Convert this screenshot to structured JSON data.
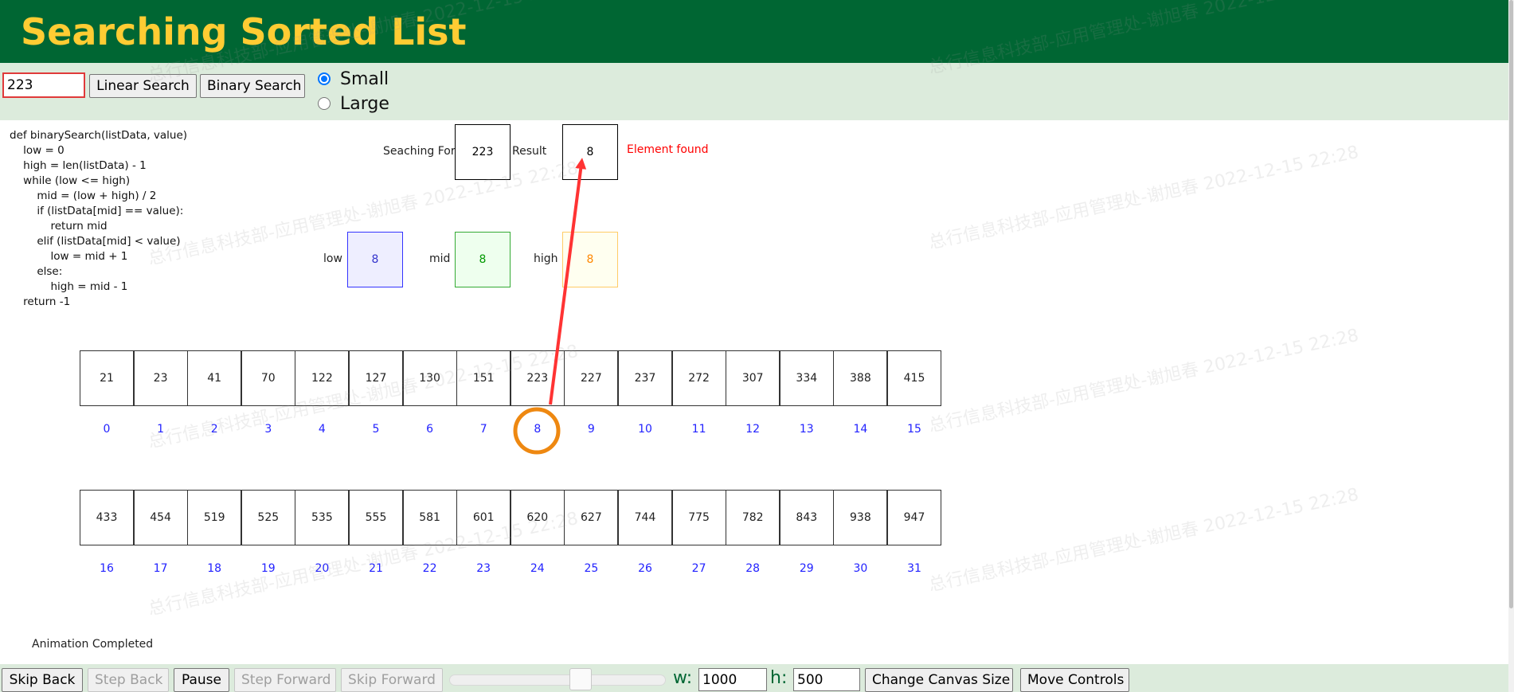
{
  "header": {
    "title": "Searching Sorted List"
  },
  "controls": {
    "search_value": "223",
    "linear_search_label": "Linear Search",
    "binary_search_label": "Binary Search",
    "radio_options": [
      {
        "label": "Small",
        "selected": true
      },
      {
        "label": "Large",
        "selected": false
      }
    ]
  },
  "code": {
    "lines": [
      "def binarySearch(listData, value)",
      "    low = 0",
      "    high = len(listData) - 1",
      "    while (low <= high)",
      "        mid = (low + high) / 2",
      "        if (listData[mid] == value):",
      "            return mid",
      "        elif (listData[mid] < value)",
      "            low = mid + 1",
      "        else:",
      "            high = mid - 1",
      "    return -1"
    ]
  },
  "search": {
    "searching_for_label": "Seaching For",
    "searching_for_value": "223",
    "result_label": "Result",
    "result_value": "8",
    "result_message": "Element found"
  },
  "pointers": {
    "low_label": "low",
    "low_value": "8",
    "mid_label": "mid",
    "mid_value": "8",
    "high_label": "high",
    "high_value": "8"
  },
  "list": {
    "row1_values": [
      "21",
      "23",
      "41",
      "70",
      "122",
      "127",
      "130",
      "151",
      "223",
      "227",
      "237",
      "272",
      "307",
      "334",
      "388",
      "415"
    ],
    "row1_indices": [
      "0",
      "1",
      "2",
      "3",
      "4",
      "5",
      "6",
      "7",
      "8",
      "9",
      "10",
      "11",
      "12",
      "13",
      "14",
      "15"
    ],
    "row2_values": [
      "433",
      "454",
      "519",
      "525",
      "535",
      "555",
      "581",
      "601",
      "620",
      "627",
      "744",
      "775",
      "782",
      "843",
      "938",
      "947"
    ],
    "row2_indices": [
      "16",
      "17",
      "18",
      "19",
      "20",
      "21",
      "22",
      "23",
      "24",
      "25",
      "26",
      "27",
      "28",
      "29",
      "30",
      "31"
    ],
    "highlighted_index": 8
  },
  "status": {
    "text": "Animation Completed"
  },
  "animation_controls": {
    "skip_back": "Skip Back",
    "step_back": "Step Back",
    "pause": "Pause",
    "step_forward": "Step Forward",
    "skip_forward": "Skip Forward",
    "speed_percent": 62,
    "width_label": "w:",
    "width_value": "1000",
    "height_label": "h:",
    "height_value": "500",
    "change_canvas_label": "Change Canvas Size",
    "move_controls_label": "Move Controls"
  },
  "watermark": {
    "text": "总行信息科技部-应用管理处-谢旭春  2022-12-15  22:28"
  },
  "colors": {
    "header_bg": "#006633",
    "title": "#ffcc33",
    "low_fill": "#eeeeff",
    "low_text": "#3333cc",
    "low_border": "#3333ff",
    "mid_fill": "#eeffee",
    "mid_text": "#009900",
    "mid_border": "#33aa33",
    "high_fill": "#fffff0",
    "high_text": "#ff8800",
    "high_border": "#ffcc66",
    "arrow": "#ff3333",
    "highlight_circle": "#ee8811",
    "index_text": "#2222ff"
  }
}
